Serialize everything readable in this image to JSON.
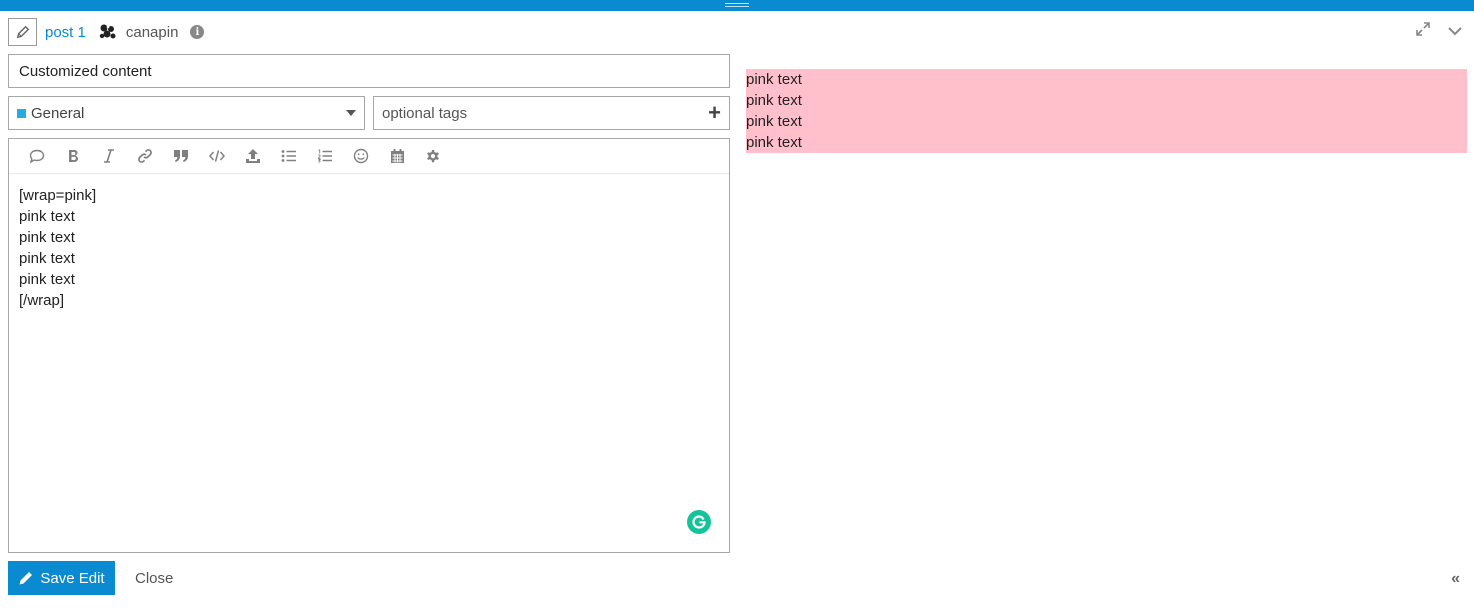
{
  "header": {
    "post_link": "post 1",
    "username": "canapin",
    "info_glyph": "i",
    "icons": {
      "edit": "pencil-icon",
      "avatar": "user-avatar-icon",
      "info": "info-circle-icon",
      "fullscreen": "expand-icon",
      "minimize": "chevron-down-icon"
    }
  },
  "title_field": {
    "value": "Customized content"
  },
  "category": {
    "label": "General",
    "color": "#25aae1"
  },
  "tags": {
    "placeholder": "optional tags",
    "add_glyph": "+"
  },
  "toolbar": {
    "buttons": [
      "quote-icon",
      "bold-icon",
      "italic-icon",
      "link-icon",
      "blockquote-icon",
      "code-icon",
      "upload-icon",
      "bullet-list-icon",
      "numbered-list-icon",
      "emoji-icon",
      "calendar-icon",
      "gear-icon"
    ]
  },
  "editor": {
    "content": "[wrap=pink]\npink text\npink text\npink text\npink text\n[/wrap]"
  },
  "preview": {
    "lines": [
      "pink text",
      "pink text",
      "pink text",
      "pink text"
    ],
    "background": "#ffc0cb"
  },
  "footer": {
    "save_label": "Save Edit",
    "close_label": "Close",
    "collapse_glyph": "«"
  },
  "colors": {
    "accent": "#0a8ad1",
    "grammarly": "#15c39a"
  }
}
